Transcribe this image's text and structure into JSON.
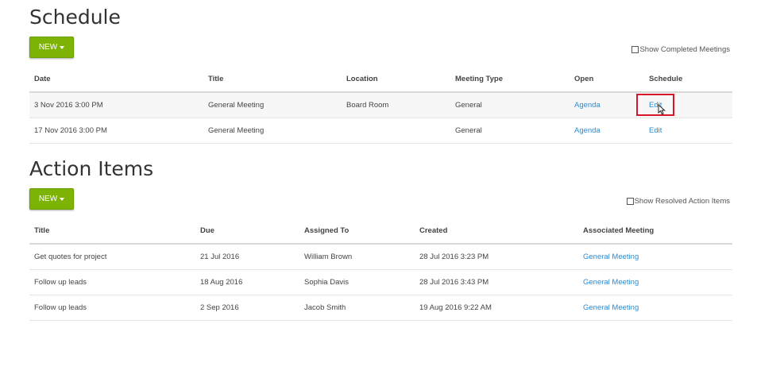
{
  "schedule": {
    "title": "Schedule",
    "new_label": "NEW",
    "show_completed_label": "Show Completed Meetings",
    "columns": [
      "Date",
      "Title",
      "Location",
      "Meeting Type",
      "Open",
      "Schedule"
    ],
    "rows": [
      {
        "date": "3 Nov 2016 3:00 PM",
        "title": "General Meeting",
        "location": "Board Room",
        "type": "General",
        "open": "Agenda",
        "schedule": "Edit"
      },
      {
        "date": "17 Nov 2016 3:00 PM",
        "title": "General Meeting",
        "location": "",
        "type": "General",
        "open": "Agenda",
        "schedule": "Edit"
      }
    ]
  },
  "action_items": {
    "title": "Action Items",
    "new_label": "NEW",
    "show_resolved_label": "Show Resolved Action Items",
    "columns": [
      "Title",
      "Due",
      "Assigned To",
      "Created",
      "Associated Meeting"
    ],
    "rows": [
      {
        "title": "Get quotes for project",
        "due": "21 Jul 2016",
        "assigned": "William Brown",
        "created": "28 Jul 2016 3:23 PM",
        "meeting": "General Meeting"
      },
      {
        "title": "Follow up leads",
        "due": "18 Aug 2016",
        "assigned": "Sophia Davis",
        "created": "28 Jul 2016 3:43 PM",
        "meeting": "General Meeting"
      },
      {
        "title": "Follow up leads",
        "due": "2 Sep 2016",
        "assigned": "Jacob Smith",
        "created": "19 Aug 2016 9:22 AM",
        "meeting": "General Meeting"
      }
    ]
  },
  "colors": {
    "accent_green": "#7cb305",
    "link_blue": "#2a8bd1",
    "highlight_red": "#d6182a"
  },
  "icons": [
    "caret-down-icon",
    "mouse-cursor-icon"
  ]
}
